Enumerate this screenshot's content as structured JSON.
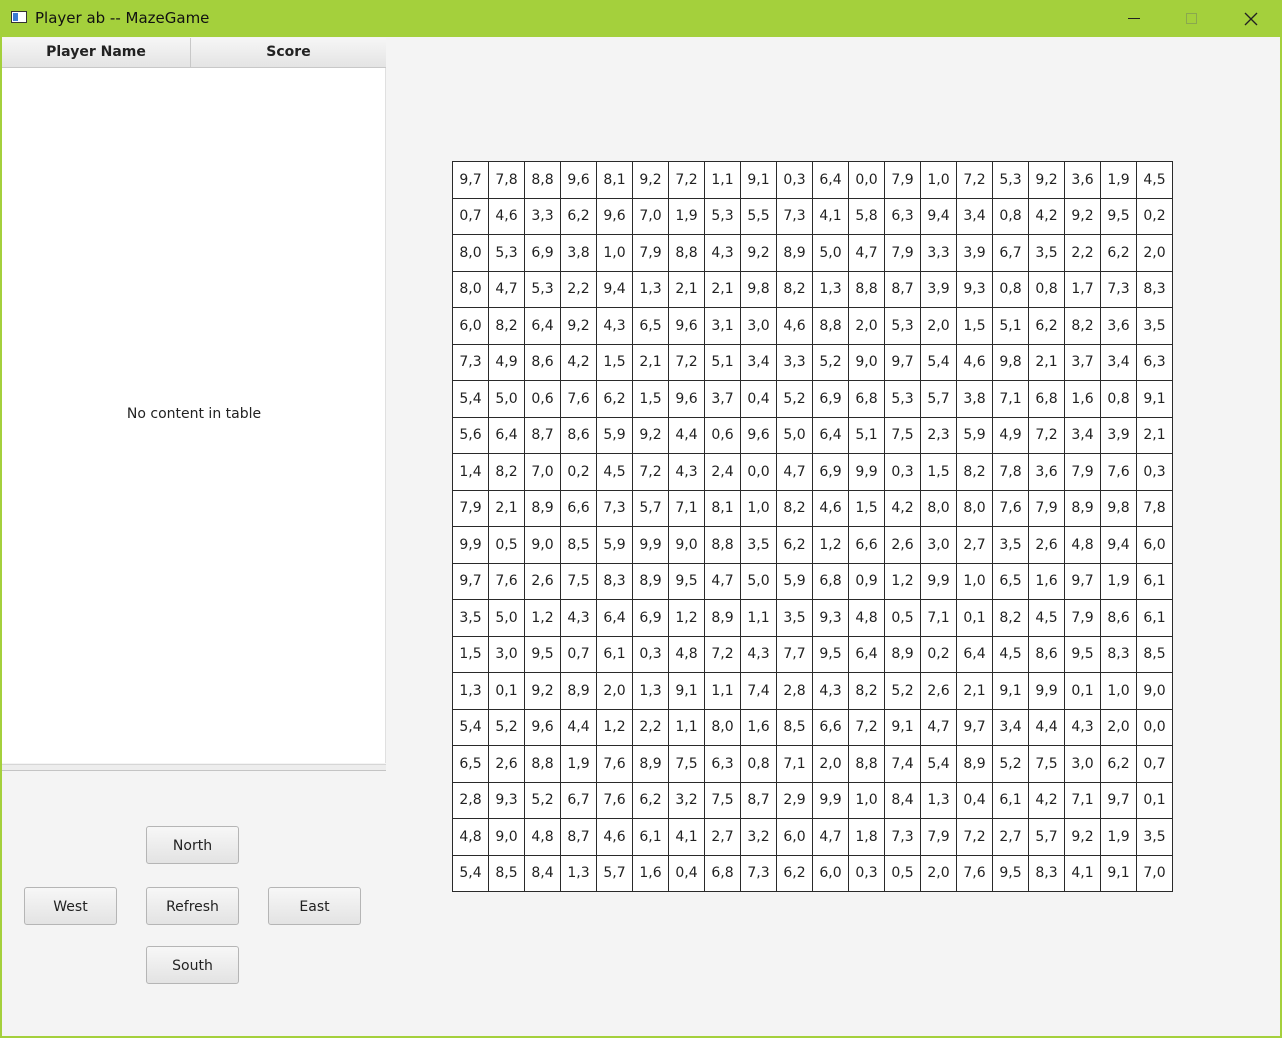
{
  "window": {
    "title": "Player ab -- MazeGame"
  },
  "table": {
    "columns": [
      "Player Name",
      "Score"
    ],
    "placeholder": "No content in table"
  },
  "controls": {
    "north": "North",
    "west": "West",
    "refresh": "Refresh",
    "east": "East",
    "south": "South"
  },
  "maze": {
    "rows": [
      [
        "9,7",
        "7,8",
        "8,8",
        "9,6",
        "8,1",
        "9,2",
        "7,2",
        "1,1",
        "9,1",
        "0,3",
        "6,4",
        "0,0",
        "7,9",
        "1,0",
        "7,2",
        "5,3",
        "9,2",
        "3,6",
        "1,9",
        "4,5"
      ],
      [
        "0,7",
        "4,6",
        "3,3",
        "6,2",
        "9,6",
        "7,0",
        "1,9",
        "5,3",
        "5,5",
        "7,3",
        "4,1",
        "5,8",
        "6,3",
        "9,4",
        "3,4",
        "0,8",
        "4,2",
        "9,2",
        "9,5",
        "0,2"
      ],
      [
        "8,0",
        "5,3",
        "6,9",
        "3,8",
        "1,0",
        "7,9",
        "8,8",
        "4,3",
        "9,2",
        "8,9",
        "5,0",
        "4,7",
        "7,9",
        "3,3",
        "3,9",
        "6,7",
        "3,5",
        "2,2",
        "6,2",
        "2,0"
      ],
      [
        "8,0",
        "4,7",
        "5,3",
        "2,2",
        "9,4",
        "1,3",
        "2,1",
        "2,1",
        "9,8",
        "8,2",
        "1,3",
        "8,8",
        "8,7",
        "3,9",
        "9,3",
        "0,8",
        "0,8",
        "1,7",
        "7,3",
        "8,3"
      ],
      [
        "6,0",
        "8,2",
        "6,4",
        "9,2",
        "4,3",
        "6,5",
        "9,6",
        "3,1",
        "3,0",
        "4,6",
        "8,8",
        "2,0",
        "5,3",
        "2,0",
        "1,5",
        "5,1",
        "6,2",
        "8,2",
        "3,6",
        "3,5"
      ],
      [
        "7,3",
        "4,9",
        "8,6",
        "4,2",
        "1,5",
        "2,1",
        "7,2",
        "5,1",
        "3,4",
        "3,3",
        "5,2",
        "9,0",
        "9,7",
        "5,4",
        "4,6",
        "9,8",
        "2,1",
        "3,7",
        "3,4",
        "6,3"
      ],
      [
        "5,4",
        "5,0",
        "0,6",
        "7,6",
        "6,2",
        "1,5",
        "9,6",
        "3,7",
        "0,4",
        "5,2",
        "6,9",
        "6,8",
        "5,3",
        "5,7",
        "3,8",
        "7,1",
        "6,8",
        "1,6",
        "0,8",
        "9,1"
      ],
      [
        "5,6",
        "6,4",
        "8,7",
        "8,6",
        "5,9",
        "9,2",
        "4,4",
        "0,6",
        "9,6",
        "5,0",
        "6,4",
        "5,1",
        "7,5",
        "2,3",
        "5,9",
        "4,9",
        "7,2",
        "3,4",
        "3,9",
        "2,1"
      ],
      [
        "1,4",
        "8,2",
        "7,0",
        "0,2",
        "4,5",
        "7,2",
        "4,3",
        "2,4",
        "0,0",
        "4,7",
        "6,9",
        "9,9",
        "0,3",
        "1,5",
        "8,2",
        "7,8",
        "3,6",
        "7,9",
        "7,6",
        "0,3"
      ],
      [
        "7,9",
        "2,1",
        "8,9",
        "6,6",
        "7,3",
        "5,7",
        "7,1",
        "8,1",
        "1,0",
        "8,2",
        "4,6",
        "1,5",
        "4,2",
        "8,0",
        "8,0",
        "7,6",
        "7,9",
        "8,9",
        "9,8",
        "7,8"
      ],
      [
        "9,9",
        "0,5",
        "9,0",
        "8,5",
        "5,9",
        "9,9",
        "9,0",
        "8,8",
        "3,5",
        "6,2",
        "1,2",
        "6,6",
        "2,6",
        "3,0",
        "2,7",
        "3,5",
        "2,6",
        "4,8",
        "9,4",
        "6,0"
      ],
      [
        "9,7",
        "7,6",
        "2,6",
        "7,5",
        "8,3",
        "8,9",
        "9,5",
        "4,7",
        "5,0",
        "5,9",
        "6,8",
        "0,9",
        "1,2",
        "9,9",
        "1,0",
        "6,5",
        "1,6",
        "9,7",
        "1,9",
        "6,1"
      ],
      [
        "3,5",
        "5,0",
        "1,2",
        "4,3",
        "6,4",
        "6,9",
        "1,2",
        "8,9",
        "1,1",
        "3,5",
        "9,3",
        "4,8",
        "0,5",
        "7,1",
        "0,1",
        "8,2",
        "4,5",
        "7,9",
        "8,6",
        "6,1"
      ],
      [
        "1,5",
        "3,0",
        "9,5",
        "0,7",
        "6,1",
        "0,3",
        "4,8",
        "7,2",
        "4,3",
        "7,7",
        "9,5",
        "6,4",
        "8,9",
        "0,2",
        "6,4",
        "4,5",
        "8,6",
        "9,5",
        "8,3",
        "8,5"
      ],
      [
        "1,3",
        "0,1",
        "9,2",
        "8,9",
        "2,0",
        "1,3",
        "9,1",
        "1,1",
        "7,4",
        "2,8",
        "4,3",
        "8,2",
        "5,2",
        "2,6",
        "2,1",
        "9,1",
        "9,9",
        "0,1",
        "1,0",
        "9,0"
      ],
      [
        "5,4",
        "5,2",
        "9,6",
        "4,4",
        "1,2",
        "2,2",
        "1,1",
        "8,0",
        "1,6",
        "8,5",
        "6,6",
        "7,2",
        "9,1",
        "4,7",
        "9,7",
        "3,4",
        "4,4",
        "4,3",
        "2,0",
        "0,0"
      ],
      [
        "6,5",
        "2,6",
        "8,8",
        "1,9",
        "7,6",
        "8,9",
        "7,5",
        "6,3",
        "0,8",
        "7,1",
        "2,0",
        "8,8",
        "7,4",
        "5,4",
        "8,9",
        "5,2",
        "7,5",
        "3,0",
        "6,2",
        "0,7"
      ],
      [
        "2,8",
        "9,3",
        "5,2",
        "6,7",
        "7,6",
        "6,2",
        "3,2",
        "7,5",
        "8,7",
        "2,9",
        "9,9",
        "1,0",
        "8,4",
        "1,3",
        "0,4",
        "6,1",
        "4,2",
        "7,1",
        "9,7",
        "0,1"
      ],
      [
        "4,8",
        "9,0",
        "4,8",
        "8,7",
        "4,6",
        "6,1",
        "4,1",
        "2,7",
        "3,2",
        "6,0",
        "4,7",
        "1,8",
        "7,3",
        "7,9",
        "7,2",
        "2,7",
        "5,7",
        "9,2",
        "1,9",
        "3,5"
      ],
      [
        "5,4",
        "8,5",
        "8,4",
        "1,3",
        "5,7",
        "1,6",
        "0,4",
        "6,8",
        "7,3",
        "6,2",
        "6,0",
        "0,3",
        "0,5",
        "2,0",
        "7,6",
        "9,5",
        "8,3",
        "4,1",
        "9,1",
        "7,0"
      ]
    ]
  },
  "icons": {
    "app": "app-window-icon",
    "minimize": "minimize-icon",
    "maximize": "maximize-icon",
    "close": "close-icon"
  },
  "colors": {
    "titlebar": "#a4d03c",
    "background": "#f4f4f4"
  }
}
